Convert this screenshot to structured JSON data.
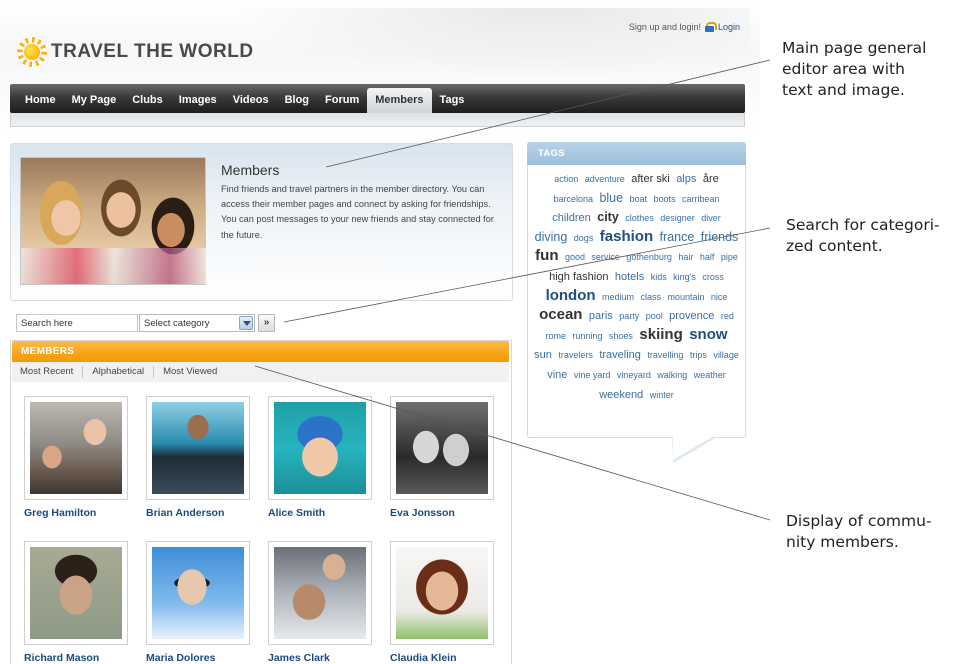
{
  "header": {
    "signup_text": "Sign up and login!",
    "login_label": "Login",
    "logo_text": "TRAVEL THE WORLD"
  },
  "nav": {
    "items": [
      "Home",
      "My Page",
      "Clubs",
      "Images",
      "Videos",
      "Blog",
      "Forum",
      "Members",
      "Tags"
    ],
    "active": "Members"
  },
  "intro": {
    "title": "Members",
    "text": "Find friends and travel partners in the member directory. You can access their member pages and connect by asking for friendships. You can post messages to your new friends and stay connected for the future."
  },
  "search": {
    "input_value": "Search here",
    "category_value": "Select category",
    "go_label": "»"
  },
  "members": {
    "header": "MEMBERS",
    "sort": [
      "Most Recent",
      "Alphabetical",
      "Most Viewed"
    ],
    "list": [
      "Greg Hamilton",
      "Brian Anderson",
      "Alice Smith",
      "Eva Jonsson",
      "Richard Mason",
      "Maria Dolores",
      "James Clark",
      "Claudia Klein"
    ]
  },
  "tags": {
    "header": "TAGS",
    "items": [
      {
        "t": "action",
        "s": 1
      },
      {
        "t": "adventure",
        "s": 1
      },
      {
        "t": "after ski",
        "s": 2,
        "d": true
      },
      {
        "t": "alps",
        "s": 2
      },
      {
        "t": "åre",
        "s": 2,
        "d": true
      },
      {
        "t": "barcelona",
        "s": 1
      },
      {
        "t": "blue",
        "s": 3
      },
      {
        "t": "boat",
        "s": 1
      },
      {
        "t": "boots",
        "s": 1
      },
      {
        "t": "carribean",
        "s": 1
      },
      {
        "t": "children",
        "s": 2
      },
      {
        "t": "city",
        "s": 3,
        "d": true,
        "b": true
      },
      {
        "t": "clothes",
        "s": 1
      },
      {
        "t": "designer",
        "s": 1
      },
      {
        "t": "diver",
        "s": 1
      },
      {
        "t": "diving",
        "s": 3
      },
      {
        "t": "dogs",
        "s": 1
      },
      {
        "t": "fashion",
        "s": 4
      },
      {
        "t": "france",
        "s": 3
      },
      {
        "t": "friends",
        "s": 3
      },
      {
        "t": "fun",
        "s": 4,
        "d": true
      },
      {
        "t": "good",
        "s": 1
      },
      {
        "t": "service",
        "s": 1
      },
      {
        "t": "gothenburg",
        "s": 1
      },
      {
        "t": "hair",
        "s": 1
      },
      {
        "t": "half",
        "s": 1
      },
      {
        "t": "pipe",
        "s": 1
      },
      {
        "t": "high fashion",
        "s": 2,
        "d": true
      },
      {
        "t": "hotels",
        "s": 2
      },
      {
        "t": "kids",
        "s": 1
      },
      {
        "t": "king's",
        "s": 1
      },
      {
        "t": "cross",
        "s": 1
      },
      {
        "t": "london",
        "s": 4
      },
      {
        "t": "medium",
        "s": 1
      },
      {
        "t": "class",
        "s": 1
      },
      {
        "t": "mountain",
        "s": 1
      },
      {
        "t": "nice",
        "s": 1
      },
      {
        "t": "ocean",
        "s": 4,
        "d": true
      },
      {
        "t": "paris",
        "s": 2
      },
      {
        "t": "party",
        "s": 1
      },
      {
        "t": "pool",
        "s": 1
      },
      {
        "t": "provence",
        "s": 2
      },
      {
        "t": "red",
        "s": 1
      },
      {
        "t": "rome",
        "s": 1
      },
      {
        "t": "running",
        "s": 1
      },
      {
        "t": "shoes",
        "s": 1
      },
      {
        "t": "skiing",
        "s": 4,
        "d": true
      },
      {
        "t": "snow",
        "s": 4
      },
      {
        "t": "sun",
        "s": 2
      },
      {
        "t": "travelers",
        "s": 1
      },
      {
        "t": "traveling",
        "s": 2
      },
      {
        "t": "travelling",
        "s": 1
      },
      {
        "t": "trips",
        "s": 1
      },
      {
        "t": "village",
        "s": 1
      },
      {
        "t": "vine",
        "s": 2
      },
      {
        "t": "vine yard",
        "s": 1
      },
      {
        "t": "vineyard",
        "s": 1
      },
      {
        "t": "walking",
        "s": 1
      },
      {
        "t": "weather",
        "s": 1
      },
      {
        "t": "weekend",
        "s": 2
      },
      {
        "t": "winter",
        "s": 1
      }
    ]
  },
  "annotations": {
    "a1": [
      "Main page general",
      "editor area with",
      "text and image."
    ],
    "a2": [
      "Search for categori-",
      "zed content."
    ],
    "a3": [
      "Display of commu-",
      "nity members."
    ]
  },
  "colors": {
    "nav_dark": "#1d1d1d",
    "members_orange": "#f7a316",
    "tags_blue": "#9dbfdc",
    "link_blue": "#1c4a7e"
  }
}
